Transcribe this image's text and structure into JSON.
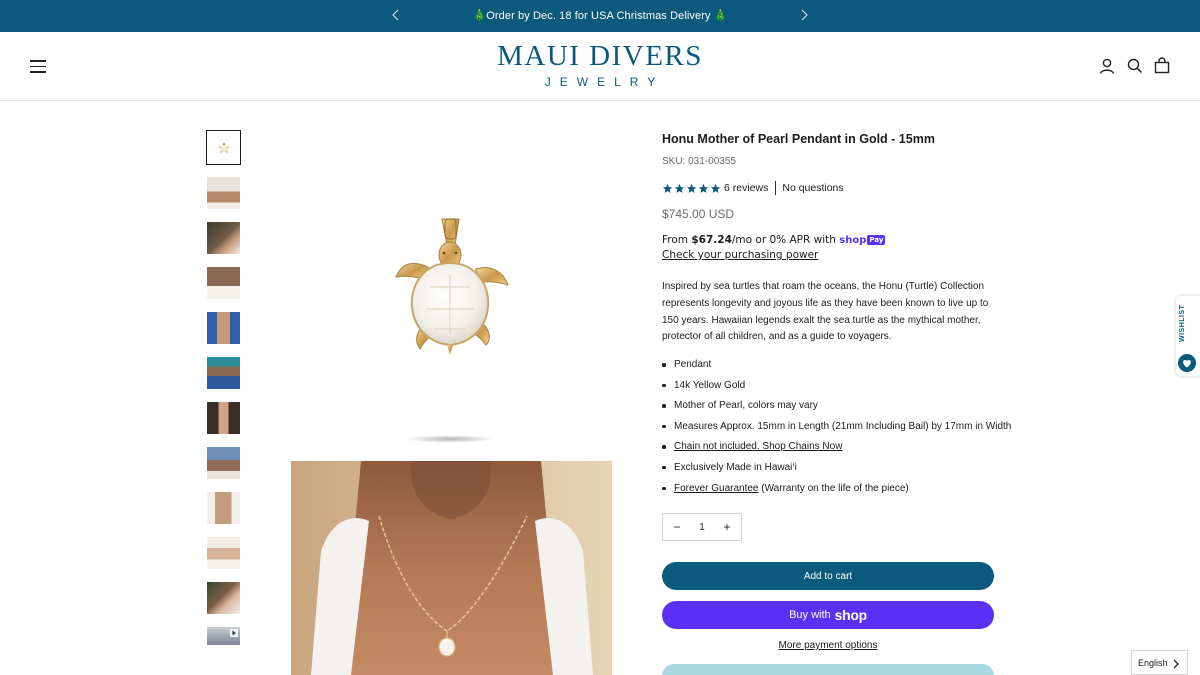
{
  "announcement": {
    "message": "🎄Order by Dec. 18 for USA Christmas Delivery 🎄"
  },
  "header": {
    "logo_line1": "MAUI DIVERS",
    "logo_line2": "JEWELRY",
    "icons": [
      "menu-icon",
      "account-icon",
      "search-icon",
      "cart-icon"
    ]
  },
  "gallery": {
    "thumbnail_count": 12,
    "active_index": 0
  },
  "product": {
    "title": "Honu Mother of Pearl Pendant in Gold - 15mm",
    "sku": "SKU: 031-00355",
    "rating_stars": 5,
    "reviews": "6 reviews",
    "questions": "No questions",
    "price": "$745.00 USD",
    "shoppay": {
      "from": "From ",
      "amount": "$67.24",
      "rest": "/mo or 0% APR with",
      "brand": "shop",
      "badge": "Pay",
      "check_link": "Check your purchasing power"
    },
    "description": "Inspired by sea turtles that roam the oceans, the Honu (Turtle) Collection represents longevity and joyous life as they have been known to live up to 150 years. Hawaiian legends exalt the sea turtle as the mythical mother, protector of all children, and as a guide to voyagers.",
    "bullets": {
      "b1": "Pendant",
      "b2": "14k Yellow Gold",
      "b3": "Mother of Pearl, colors may vary",
      "b4": "Measures Approx. 15mm in Length (21mm Including Bail) by 17mm in Width",
      "b5": "Chain not included. Shop Chains Now",
      "b6": "Exclusively Made in Hawai‘i",
      "b7_link": "Forever Guarantee",
      "b7_rest": " (Warranty on the life of the piece)"
    },
    "quantity": "1",
    "add_to_cart": "Add to cart",
    "buy_with": "Buy with",
    "buy_brand": "shop",
    "more_payment": "More payment options"
  },
  "wishlist": {
    "label": "WISHLIST"
  },
  "language": {
    "selected": "English"
  },
  "colors": {
    "brand": "#0b5a7d",
    "shop_purple": "#5a31f4",
    "accent_light": "#a6d8df"
  }
}
